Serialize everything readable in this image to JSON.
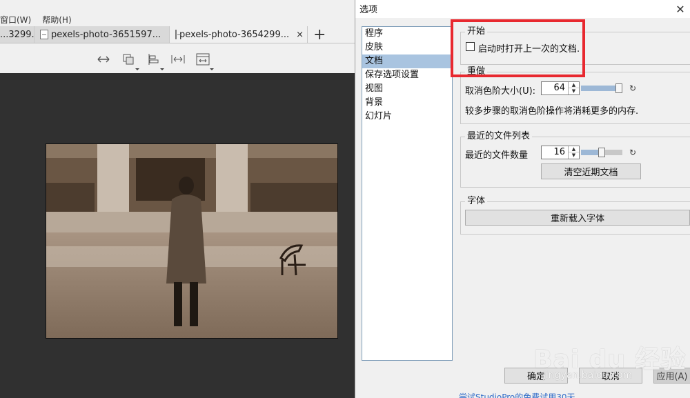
{
  "app": {
    "menu": [
      "窗口(W)",
      "帮助(H)"
    ],
    "tabs": [
      {
        "label": "...3299...",
        "active": false
      },
      {
        "label": "pexels-photo-3651597...",
        "active": false
      },
      {
        "label": "pexels-photo-3654299...",
        "active": true
      }
    ],
    "tab_close": "×",
    "tab_add": "+",
    "toolbar_icons": [
      "fit-width-icon",
      "layers-icon",
      "align-icon",
      "fit-spacing-icon",
      "fit-window-icon"
    ]
  },
  "dialog": {
    "title": "选项",
    "close": "✕",
    "nav": [
      {
        "label": "程序",
        "selected": false
      },
      {
        "label": "皮肤",
        "selected": false
      },
      {
        "label": "文档",
        "selected": true
      },
      {
        "label": "保存选项设置",
        "selected": false
      },
      {
        "label": "视图",
        "selected": false
      },
      {
        "label": "背景",
        "selected": false
      },
      {
        "label": "幻灯片",
        "selected": false
      }
    ],
    "start_group": {
      "title": "开始",
      "reopen_label": "启动时打开上一次的文档.",
      "reopen_checked": false
    },
    "undo_group": {
      "title": "重做",
      "undo_label": "取消色阶大小(U):",
      "undo_value": "64",
      "undo_level": 1.0,
      "note": "较多步骤的取消色阶操作将消耗更多的内存."
    },
    "recent_group": {
      "title": "最近的文件列表",
      "count_label": "最近的文件数量",
      "count_value": "16",
      "count_level": 0.5,
      "clear_button": "清空近期文档"
    },
    "font_group": {
      "title": "字体",
      "reload_button": "重新载入字体"
    },
    "reset_glyph": "↻",
    "spin_up": "▲",
    "spin_down": "▼",
    "buttons": {
      "ok": "确定",
      "cancel": "取消",
      "apply": "应用(A)"
    },
    "footer_link": "尝试StudioPro的免费试用30天"
  },
  "watermark": {
    "logo": "Bai du 经验",
    "url": "jingyan.baidu.com"
  },
  "colors": {
    "highlight": "#e8282f",
    "nav_selected": "#a9c4e0",
    "viewer_bg": "#303030"
  }
}
